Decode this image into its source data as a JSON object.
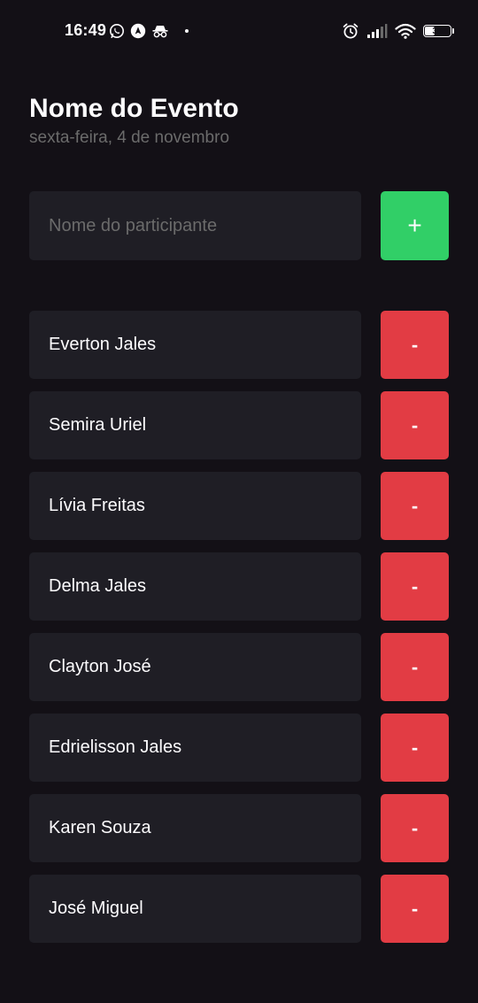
{
  "status_bar": {
    "time": "16:49",
    "battery_text": "36",
    "battery_level": 0.36,
    "left_icons": [
      "whatsapp-icon",
      "navigation-app-icon",
      "incognito-icon"
    ],
    "right_icons": [
      "alarm-icon",
      "signal-icon",
      "wifi-icon",
      "battery-icon"
    ]
  },
  "event": {
    "title": "Nome do Evento",
    "date": "sexta-feira, 4 de novembro"
  },
  "form": {
    "placeholder": "Nome do participante",
    "value": "",
    "add_label": "+"
  },
  "participants": [
    {
      "name": "Everton Jales",
      "remove_label": "-"
    },
    {
      "name": "Semira Uriel",
      "remove_label": "-"
    },
    {
      "name": "Lívia Freitas",
      "remove_label": "-"
    },
    {
      "name": "Delma Jales",
      "remove_label": "-"
    },
    {
      "name": "Clayton José",
      "remove_label": "-"
    },
    {
      "name": "Edrielisson Jales",
      "remove_label": "-"
    },
    {
      "name": "Karen Souza",
      "remove_label": "-"
    },
    {
      "name": "José Miguel",
      "remove_label": "-"
    }
  ],
  "colors": {
    "background": "#131016",
    "surface": "#1F1E25",
    "text": "#FDFCFE",
    "muted_text": "#6B6B6B",
    "add_green": "#31CF67",
    "remove_red": "#E23C44"
  }
}
